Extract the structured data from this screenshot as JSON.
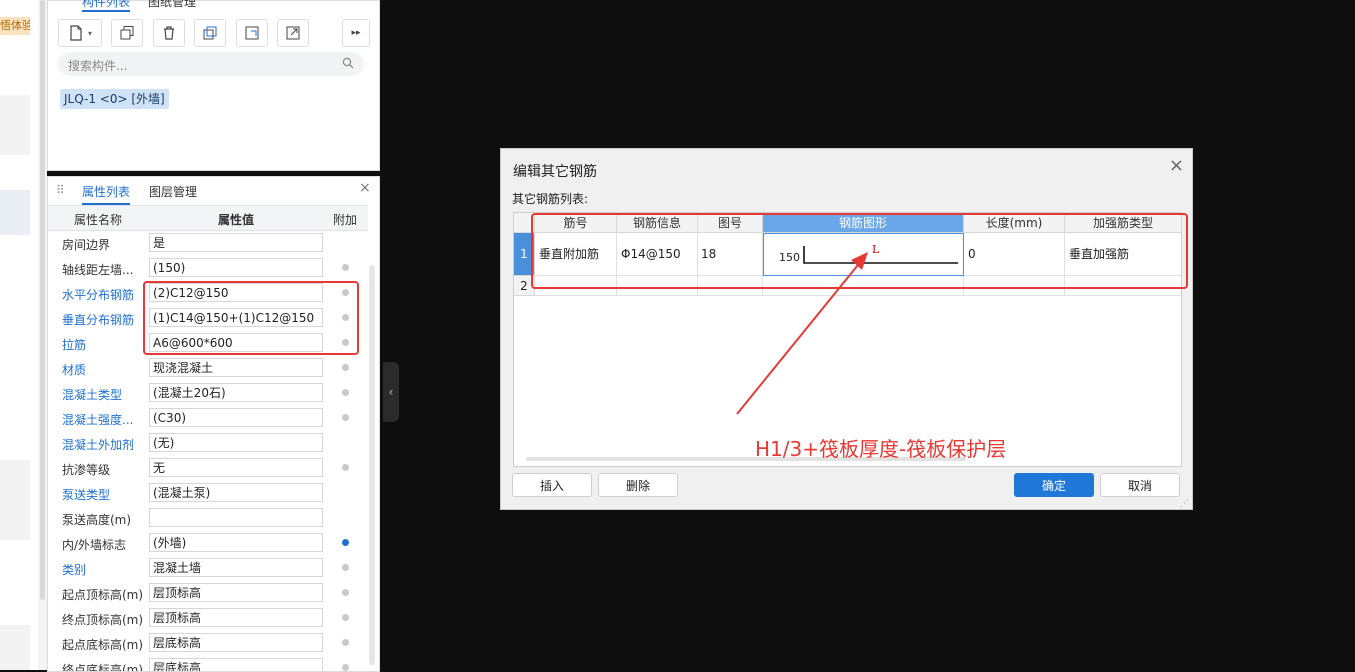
{
  "left_strip": {
    "badge": "悟体验"
  },
  "top_panel": {
    "tabs": [
      "构件列表",
      "图纸管理"
    ],
    "search_placeholder": "搜索构件...",
    "component_item": "JLQ-1 <0> [外墙]"
  },
  "prop_panel": {
    "tabs": [
      "属性列表",
      "图层管理"
    ],
    "headers": [
      "属性名称",
      "属性值",
      "附加"
    ],
    "rows": [
      {
        "name": "房间边界",
        "value": "是",
        "blue": false,
        "dot": "none"
      },
      {
        "name": "轴线距左墙...",
        "value": "(150)",
        "blue": false,
        "dot": "grey"
      },
      {
        "name": "水平分布钢筋",
        "value": "(2)C12@150",
        "blue": true,
        "dot": "grey"
      },
      {
        "name": "垂直分布钢筋",
        "value": "(1)C14@150+(1)C12@150",
        "blue": true,
        "dot": "grey"
      },
      {
        "name": "拉筋",
        "value": "A6@600*600",
        "blue": true,
        "dot": "grey"
      },
      {
        "name": "材质",
        "value": "现浇混凝土",
        "blue": true,
        "dot": "grey"
      },
      {
        "name": "混凝土类型",
        "value": "(混凝土20石)",
        "blue": true,
        "dot": "grey"
      },
      {
        "name": "混凝土强度...",
        "value": "(C30)",
        "blue": true,
        "dot": "grey"
      },
      {
        "name": "混凝土外加剂",
        "value": "(无)",
        "blue": true,
        "dot": "none"
      },
      {
        "name": "抗渗等级",
        "value": "无",
        "blue": false,
        "dot": "grey"
      },
      {
        "name": "泵送类型",
        "value": "(混凝土泵)",
        "blue": true,
        "dot": "none"
      },
      {
        "name": "泵送高度(m)",
        "value": "",
        "blue": false,
        "dot": "none"
      },
      {
        "name": "内/外墙标志",
        "value": "(外墙)",
        "blue": false,
        "dot": "blue"
      },
      {
        "name": "类别",
        "value": "混凝土墙",
        "blue": true,
        "dot": "grey"
      },
      {
        "name": "起点顶标高(m)",
        "value": "层顶标高",
        "blue": false,
        "dot": "grey"
      },
      {
        "name": "终点顶标高(m)",
        "value": "层顶标高",
        "blue": false,
        "dot": "grey"
      },
      {
        "name": "起点底标高(m)",
        "value": "层底标高",
        "blue": false,
        "dot": "grey"
      },
      {
        "name": "终点底标高(m)",
        "value": "层底标高",
        "blue": false,
        "dot": "grey"
      }
    ]
  },
  "dialog": {
    "title": "编辑其它钢筋",
    "list_label": "其它钢筋列表:",
    "columns": [
      "筋号",
      "钢筋信息",
      "图号",
      "钢筋图形",
      "长度(mm)",
      "加强筋类型"
    ],
    "rows": [
      {
        "num": "1",
        "name": "垂直附加筋",
        "info": "Φ14@150",
        "fig": "18",
        "shape_dim": "150",
        "shape_label": "L",
        "length": "0",
        "type": "垂直加强筋"
      },
      {
        "num": "2",
        "name": "",
        "info": "",
        "fig": "",
        "shape_dim": "",
        "shape_label": "",
        "length": "",
        "type": ""
      }
    ],
    "buttons": {
      "insert": "插入",
      "delete": "删除",
      "ok": "确定",
      "cancel": "取消"
    }
  },
  "annotation": "H1/3+筏板厚度-筏板保护层",
  "colors": {
    "accent": "#1f78d8",
    "annotation_red": "#e53935"
  }
}
